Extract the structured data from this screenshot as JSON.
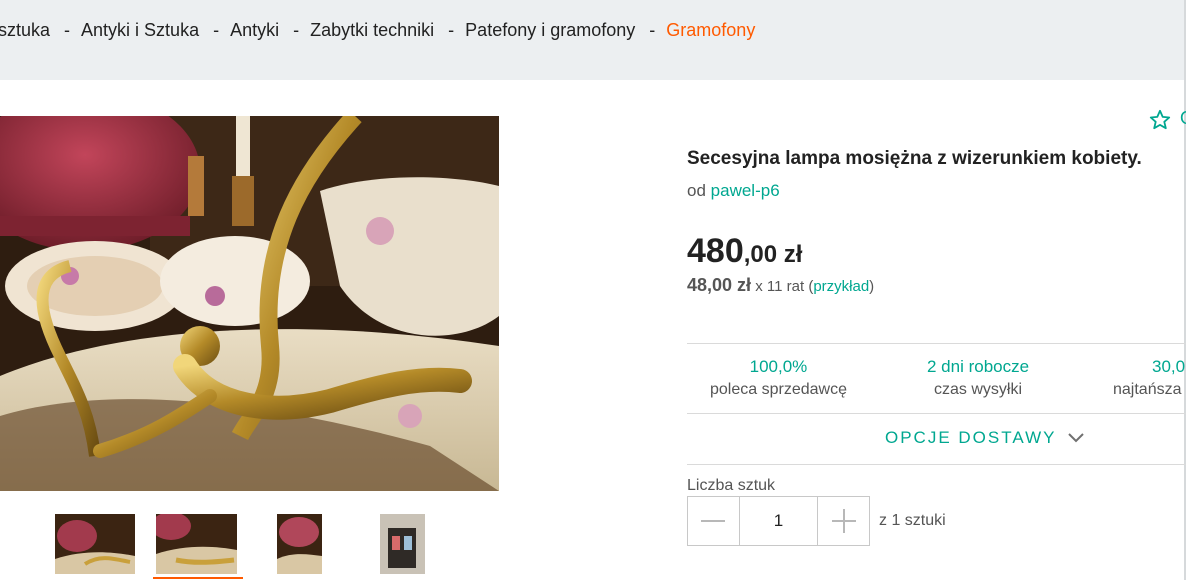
{
  "breadcrumb": {
    "items": [
      "sztuka",
      "Antyki i Sztuka",
      "Antyki",
      "Zabytki techniki",
      "Patefony i gramofony",
      "Gramofony"
    ],
    "separator": "-"
  },
  "offer": {
    "title": "Secesyjna lampa mosiężna z wizerunkiem kobiety.",
    "seller_prefix": "od",
    "seller_name": "pawel-p6",
    "price_main": "480",
    "price_rest": ",00 zł",
    "installment_amount": "48,00 zł",
    "installment_text": "x 11 rat",
    "installment_paren_open": "(",
    "installment_link": "przykład",
    "installment_paren_close": ")",
    "favorite_label_cut": "O"
  },
  "stats": [
    {
      "value": "100,0%",
      "label": "poleca sprzedawcę"
    },
    {
      "value": "2 dni robocze",
      "label": "czas wysyłki"
    },
    {
      "value": "30,0",
      "label": "najtańsza"
    }
  ],
  "delivery": {
    "label": "OPCJE DOSTAWY"
  },
  "quantity": {
    "label": "Liczba sztuk",
    "value": "1",
    "of_text": "z 1 sztuki"
  },
  "colors": {
    "accent": "#00a790",
    "brand_orange": "#ff5a00",
    "crumb_bg": "#eceff1"
  },
  "icons": {
    "favorite": "star-outline-icon",
    "expand": "chevron-down-icon",
    "minus": "minus-icon",
    "plus": "plus-icon"
  }
}
